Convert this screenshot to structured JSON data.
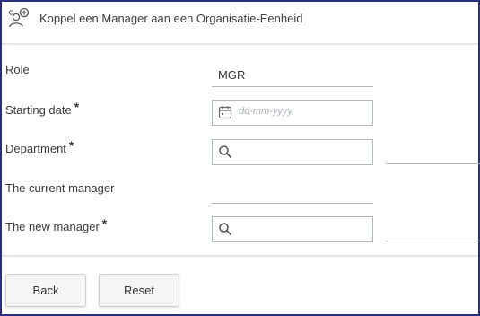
{
  "header": {
    "title": "Koppel een Manager aan een Organisatie-Eenheid",
    "icon": "link-manager-icon"
  },
  "form": {
    "role": {
      "label": "Role",
      "value": "MGR"
    },
    "starting_date": {
      "label": "Starting date",
      "required_mark": "*",
      "placeholder": "dd-mm-yyyy",
      "icon": "calendar-icon"
    },
    "department": {
      "label": "Department",
      "required_mark": "*",
      "icon": "search-icon"
    },
    "current_manager": {
      "label": "The current manager"
    },
    "new_manager": {
      "label": "The new manager",
      "required_mark": "*",
      "icon": "search-icon"
    }
  },
  "buttons": {
    "back": "Back",
    "reset": "Reset"
  },
  "colors": {
    "frame_border": "#2b2f7a",
    "field_border": "#aeb9c2",
    "placeholder": "#a8b0b6"
  }
}
